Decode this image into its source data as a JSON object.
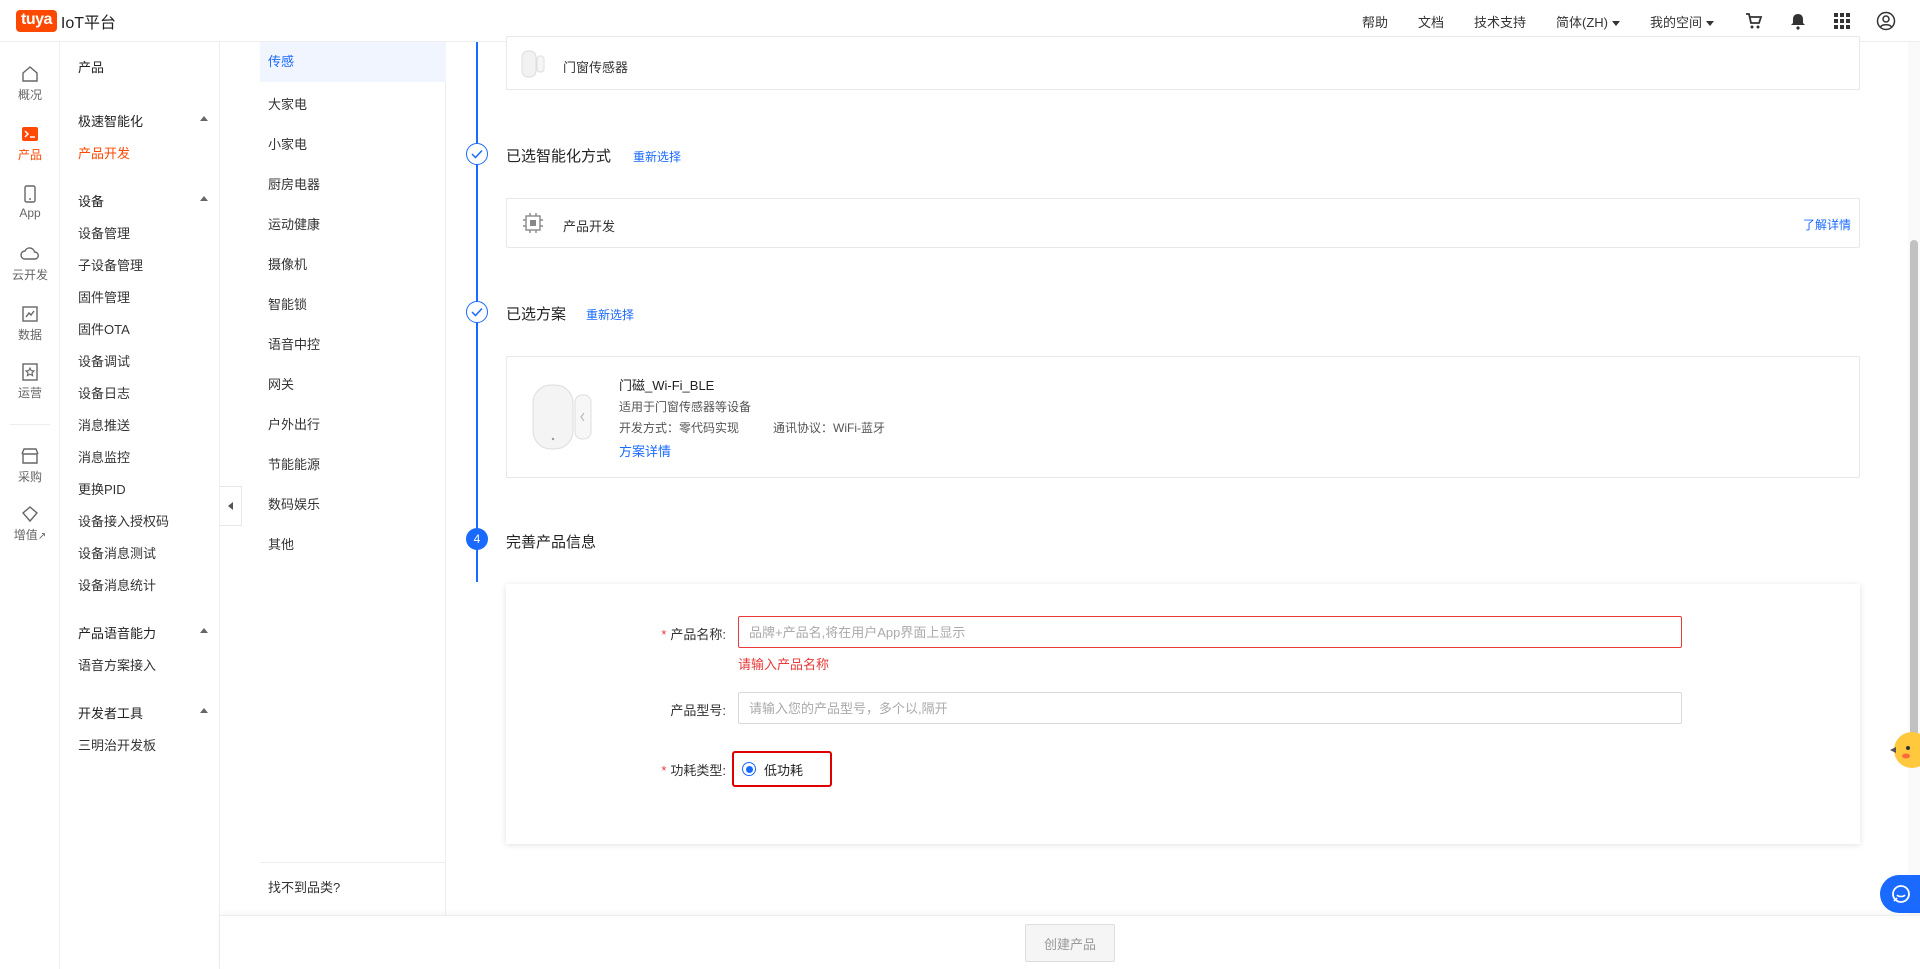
{
  "header": {
    "logo_badge": "tuya",
    "logo_text": "IoT平台",
    "nav": [
      "帮助",
      "文档",
      "技术支持"
    ],
    "language": "简体(ZH)",
    "space": "我的空间",
    "icons": [
      "cart-icon",
      "bell-icon",
      "apps-grid-icon",
      "user-avatar-icon"
    ]
  },
  "rail": {
    "items": [
      {
        "label": "概况",
        "icon": "home-icon"
      },
      {
        "label": "产品",
        "icon": "terminal-icon",
        "active": true
      },
      {
        "label": "App",
        "icon": "phone-icon"
      },
      {
        "label": "云开发",
        "icon": "cloud-icon"
      },
      {
        "label": "数据",
        "icon": "chart-icon"
      },
      {
        "label": "运营",
        "icon": "star-badge-icon"
      },
      {
        "label": "采购",
        "icon": "store-icon"
      },
      {
        "label": "增值",
        "icon": "diamond-icon"
      }
    ]
  },
  "menu": {
    "title": "产品",
    "groups": [
      {
        "label": "极速智能化",
        "items": [
          "产品开发"
        ]
      },
      {
        "label": "设备",
        "items": [
          "设备管理",
          "子设备管理",
          "固件管理",
          "固件OTA",
          "设备调试",
          "设备日志",
          "消息推送",
          "消息监控",
          "更换PID",
          "设备接入授权码",
          "设备消息测试",
          "设备消息统计"
        ]
      },
      {
        "label": "产品语音能力",
        "items": [
          "语音方案接入"
        ]
      },
      {
        "label": "开发者工具",
        "items": [
          "三明治开发板"
        ]
      }
    ],
    "active_item": "产品开发"
  },
  "categories": {
    "items": [
      "传感",
      "大家电",
      "小家电",
      "厨房电器",
      "运动健康",
      "摄像机",
      "智能锁",
      "语音中控",
      "网关",
      "户外出行",
      "节能能源",
      "数码娱乐",
      "其他"
    ],
    "active": "传感",
    "footer": "找不到品类?"
  },
  "steps": {
    "category_card_label": "门窗传感器",
    "step2_title": "已选智能化方式",
    "step2_link": "重新选择",
    "step2_card_label": "产品开发",
    "step2_card_link": "了解详情",
    "step3_title": "已选方案",
    "step3_link": "重新选择",
    "scheme": {
      "name": "门磁_Wi-Fi_BLE",
      "desc": "适用于门窗传感器等设备",
      "dev_mode": "开发方式：零代码实现",
      "protocol": "通讯协议：WiFi-蓝牙",
      "detail_link": "方案详情"
    },
    "step4_number": "4",
    "step4_title": "完善产品信息"
  },
  "form": {
    "name_label": "产品名称:",
    "name_placeholder": "品牌+产品名,将在用户App界面上显示",
    "name_error": "请输入产品名称",
    "model_label": "产品型号:",
    "model_placeholder": "请输入您的产品型号，多个以,隔开",
    "power_label": "功耗类型:",
    "power_option": "低功耗",
    "required_mark": "*"
  },
  "footer": {
    "create_button": "创建产品"
  },
  "colors": {
    "brand": "#ff4800",
    "primary": "#1a6aff",
    "error": "#e83a3a",
    "highlight_box": "#e00000"
  }
}
